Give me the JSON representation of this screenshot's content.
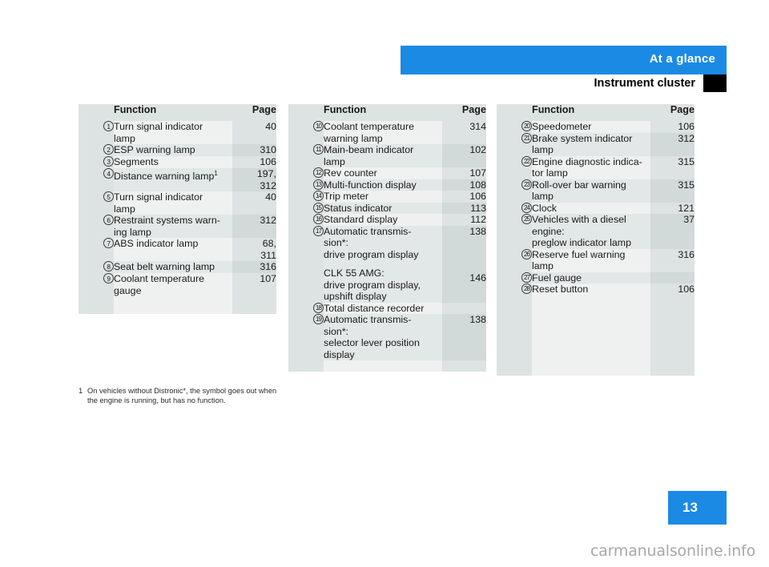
{
  "header": {
    "band_title": "At a glance",
    "sub_title": "Instrument cluster",
    "band_color": "#1b8ae4",
    "marker_color": "#000000"
  },
  "table_headers": {
    "function": "Function",
    "page": "Page"
  },
  "columns": [
    {
      "id": "col-1",
      "rows": [
        {
          "num": "1",
          "function": "Turn signal indicator\nlamp",
          "page": "40"
        },
        {
          "num": "2",
          "function": "ESP warning lamp",
          "page": "310"
        },
        {
          "num": "3",
          "function": "Segments",
          "page": "106"
        },
        {
          "num": "4",
          "function": "Distance warning lamp",
          "footnote_ref": "1",
          "page": "197,\n312"
        },
        {
          "num": "5",
          "function": "Turn signal indicator\nlamp",
          "page": "40"
        },
        {
          "num": "6",
          "function": "Restraint systems warn-\ning lamp",
          "page": "312"
        },
        {
          "num": "7",
          "function": "ABS indicator lamp",
          "page": "68,\n311"
        },
        {
          "num": "8",
          "function": "Seat belt warning lamp",
          "page": "316"
        },
        {
          "num": "9",
          "function": "Coolant temperature\ngauge",
          "page": "107"
        }
      ]
    },
    {
      "id": "col-2",
      "rows": [
        {
          "num": "10",
          "function": "Coolant temperature\nwarning lamp",
          "page": "314"
        },
        {
          "num": "11",
          "function": "Main-beam indicator\nlamp",
          "page": "102"
        },
        {
          "num": "12",
          "function": "Rev counter",
          "page": "107"
        },
        {
          "num": "13",
          "function": "Multi-function display",
          "page": "108"
        },
        {
          "num": "14",
          "function": "Trip meter",
          "page": "106"
        },
        {
          "num": "15",
          "function": "Status indicator",
          "page": "113"
        },
        {
          "num": "16",
          "function": "Standard display",
          "page": "112"
        },
        {
          "num": "17",
          "function": "Automatic transmis-\nsion*:\ndrive program display",
          "page": "138",
          "extra_function": "CLK 55 AMG:\ndrive program display,\nupshift display",
          "extra_page": "146"
        },
        {
          "num": "18",
          "function": "Total distance recorder",
          "page": ""
        },
        {
          "num": "19",
          "function": "Automatic transmis-\nsion*:\nselector lever position\ndisplay",
          "page": "138"
        }
      ]
    },
    {
      "id": "col-3",
      "rows": [
        {
          "num": "20",
          "function": "Speedometer",
          "page": "106"
        },
        {
          "num": "21",
          "function": "Brake system indicator\nlamp",
          "page": "312"
        },
        {
          "num": "22",
          "function": "Engine diagnostic indica-\ntor lamp",
          "page": "315"
        },
        {
          "num": "23",
          "function": "Roll-over bar warning\nlamp",
          "page": "315"
        },
        {
          "num": "24",
          "function": "Clock",
          "page": "121"
        },
        {
          "num": "25",
          "function": "Vehicles with a diesel\nengine:\npreglow indicator lamp",
          "page": "37"
        },
        {
          "num": "26",
          "function": "Reserve fuel warning\nlamp",
          "page": "316"
        },
        {
          "num": "27",
          "function": "Fuel gauge",
          "page": ""
        },
        {
          "num": "28",
          "function": "Reset button",
          "page": "106"
        }
      ]
    }
  ],
  "footnote": {
    "marker": "1",
    "text": "On vehicles without Distronic*, the symbol goes out when the engine is running, but has no function."
  },
  "page_number": "13",
  "watermark": "carmanualsonline.info"
}
